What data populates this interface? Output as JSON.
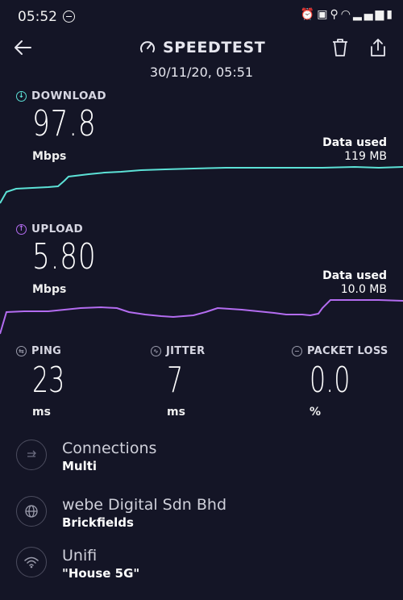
{
  "status_bar": {
    "time": "05:52"
  },
  "header": {
    "title": "SPEEDTEST",
    "datetime": "30/11/20, 05:51"
  },
  "download": {
    "label": "DOWNLOAD",
    "value": "97.8",
    "unit": "Mbps",
    "data_used_label": "Data used",
    "data_used_value": "119 MB",
    "color": "#5ce1d6"
  },
  "upload": {
    "label": "UPLOAD",
    "value": "5.80",
    "unit": "Mbps",
    "data_used_label": "Data used",
    "data_used_value": "10.0 MB",
    "color": "#b36cf0"
  },
  "ping": {
    "label": "PING",
    "value": "23",
    "unit": "ms"
  },
  "jitter": {
    "label": "JITTER",
    "value": "7",
    "unit": "ms"
  },
  "packet_loss": {
    "label": "PACKET LOSS",
    "value": "0.0",
    "unit": "%"
  },
  "connections": {
    "title": "Connections",
    "subtitle": "Multi"
  },
  "provider": {
    "title": "webe Digital Sdn Bhd",
    "subtitle": "Brickfields"
  },
  "network": {
    "title": "Unifi",
    "subtitle": "\"House 5G\""
  }
}
